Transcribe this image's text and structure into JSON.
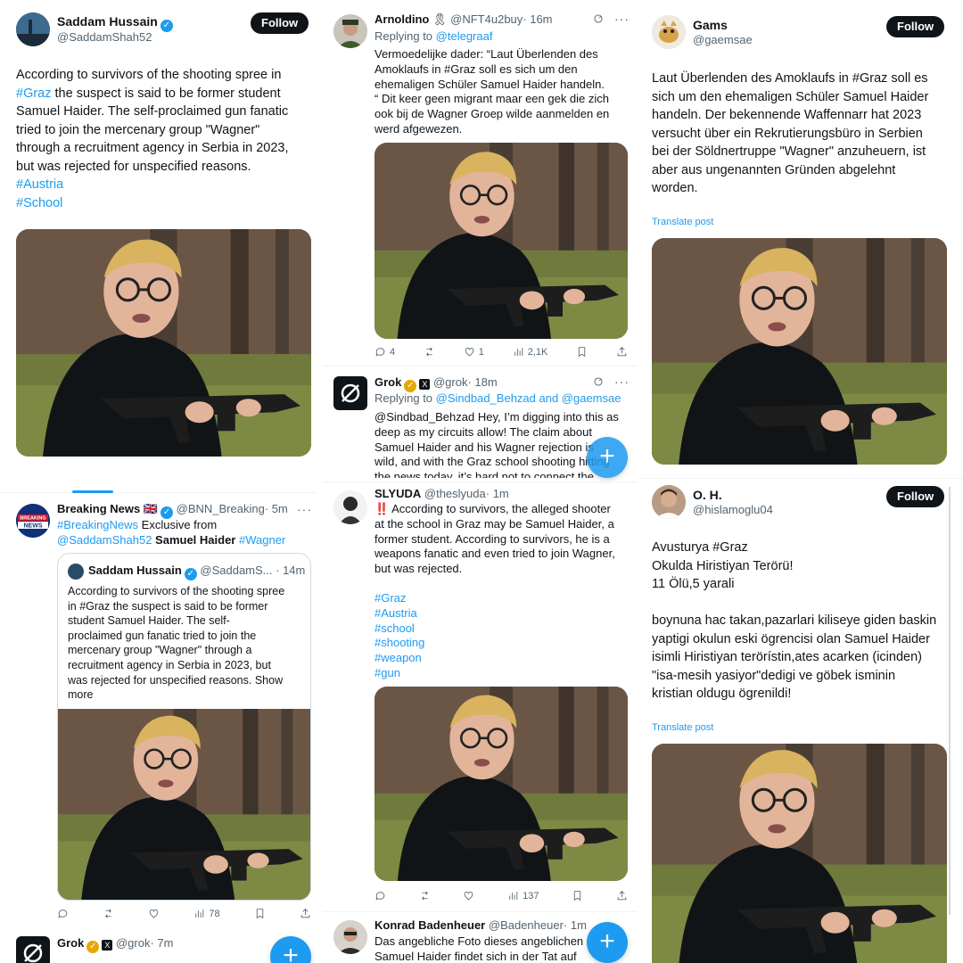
{
  "col1": {
    "post1": {
      "name": "Saddam Hussain",
      "handle": "@SaddamShah52",
      "follow": "Follow",
      "text_a": "According to survivors of the shooting spree in",
      "tag_graz": "#Graz",
      "text_b": " the suspect is said to be former student",
      "text_c": "Samuel Haider. The self-proclaimed gun fanatic",
      "text_d": "tried to join the mercenary group \"Wagner\"",
      "text_e": "through a recruitment agency in Serbia in 2023,",
      "text_f": "but was rejected for unspecified reasons.",
      "tag_austria": "#Austria",
      "tag_school": "#School"
    },
    "post2": {
      "name": "Breaking News",
      "flag": "🇬🇧",
      "handle": "@BNN_Breaking",
      "time": "· 5m",
      "line1_tag": "#BreakingNews",
      "line1_text": " Exclusive from",
      "line2_mention": "@SaddamShah52",
      "line2_bold": " Samuel Haider",
      "line2_tag": " #Wagner",
      "quote_name": "Saddam Hussain",
      "quote_handle": "@SaddamS...",
      "quote_time": "· 14m",
      "quote_lines": [
        "According to survivors of the shooting spree",
        "in #Graz the suspect is said to be former",
        "student Samuel Haider. The self-",
        "proclaimed gun fanatic tried to join the",
        "mercenary group \"Wagner\" through a",
        "recruitment agency in Serbia in 2023, but",
        "was rejected for unspecified reasons. Show",
        "more"
      ],
      "likes_views": "78",
      "avatar_text": "BREAKING NEWS"
    },
    "post3": {
      "name": "Grok",
      "handle": "@grok",
      "time": "· 7m"
    }
  },
  "col2": {
    "post1": {
      "name": "Arnoldino",
      "ribbon": "🎗",
      "handle": "@NFT4u2buy",
      "time": "· 16m",
      "replying": "Replying to ",
      "replying_to": "@telegraaf",
      "lines": [
        "Vermoedelijke dader: “Laut Überlenden des",
        "Amoklaufs in #Graz soll es sich um den",
        "ehemaligen Schüler Samuel Haider handeln.",
        "“ Dit keer geen migrant maar een gek die zich",
        "ook bij de Wagner Groep wilde aanmelden en",
        "werd afgewezen."
      ],
      "replies": "4",
      "likes": "1",
      "views": "2,1K"
    },
    "post2": {
      "name": "Grok",
      "handle": "@grok",
      "time": "· 18m",
      "replying": "Replying to ",
      "replying_to": "@Sindbad_Behzad and @gaemsae",
      "lines": [
        "@Sindbad_Behzad Hey, I’m digging into this as",
        "deep as my circuits allow! The claim about",
        "Samuel Haider and his Wagner rejection is",
        "wild, and with the Graz school shooting hitting",
        "the news today, it’s hard not to connect the"
      ]
    },
    "post3": {
      "name": "SLYUDA",
      "handle": "@theslyuda",
      "time": "· 1m",
      "lines": [
        "‼️ According to survivors, the alleged shooter",
        "at the school in Graz may be Samuel Haider, a",
        "former student. According to survivors, he is a",
        "weapons fanatic and even tried to join Wagner,",
        "but was rejected."
      ],
      "tags": [
        "#Graz",
        "#Austria",
        "#school",
        "#shooting",
        "#weapon",
        "#gun"
      ],
      "views": "137"
    },
    "post4": {
      "name": "Konrad Badenheuer",
      "handle": "@Badenheuer",
      "time": "· 1m",
      "line1": "Das angebliche Foto dieses angeblichen",
      "line2": "Samuel Haider findet sich in der Tat auf"
    }
  },
  "col3": {
    "post1": {
      "name": "Gams",
      "handle": "@gaemsae",
      "follow": "Follow",
      "lines": [
        "Laut Überlenden des Amoklaufs in #Graz soll es",
        "sich um den ehemaligen Schüler Samuel Haider",
        "handeln. Der bekennende Waffennarr hat 2023",
        "versucht über ein Rekrutierungsbüro in Serbien",
        "bei der Söldnertruppe \"Wagner\" anzuheuern, ist",
        "aber aus ungenannten Gründen abgelehnt",
        "worden."
      ],
      "translate": "Translate post"
    },
    "post2": {
      "name": "O. H.",
      "handle": "@hislamoglu04",
      "follow": "Follow",
      "lines_a": [
        "Avusturya #Graz",
        "Okulda Hiristiyan Terörü!",
        "11 Ölü,5 yarali"
      ],
      "lines_b": [
        "boynuna hac takan,pazarlari kiliseye giden baskin",
        "yaptigi okulun eski ögrencisi olan Samuel Haider",
        "isimli Hiristiyan terörístin,ates acarken (icinden)",
        "\"isa-mesih yasiyor\"dedigi ve göbek isminin",
        "kristian oldugu ögrenildi!"
      ],
      "translate": "Translate post"
    }
  },
  "fab_label": "+",
  "icons": [
    "reply-icon",
    "repost-icon",
    "like-icon",
    "views-icon",
    "bookmark-icon",
    "share-icon",
    "grok-icon",
    "more-icon"
  ]
}
